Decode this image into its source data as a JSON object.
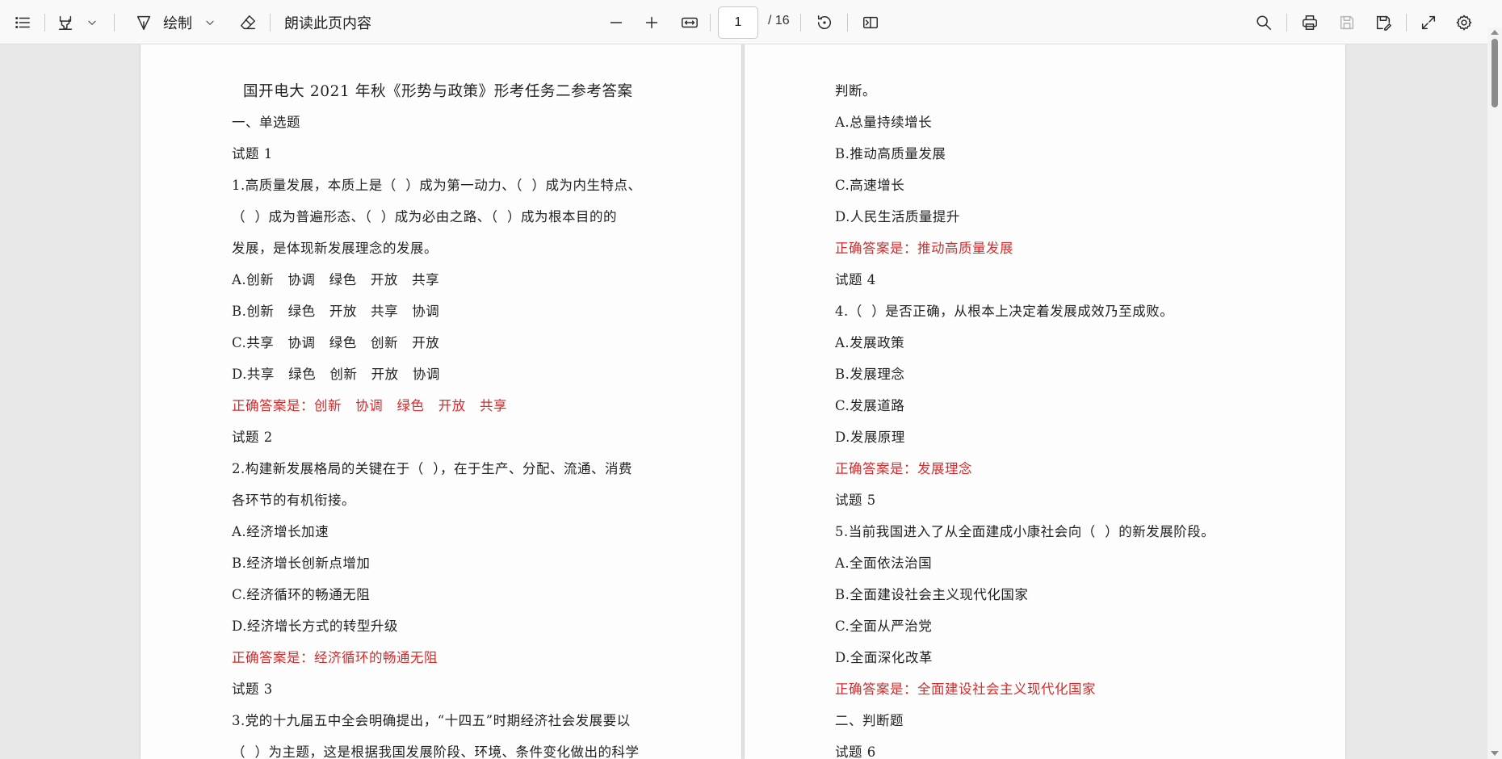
{
  "toolbar": {
    "draw_label": "绘制",
    "read_aloud_label": "朗读此页内容",
    "page_current": "1",
    "page_total": "/ 16"
  },
  "pages": {
    "left": [
      {
        "text": "国开电大 2021 年秋《形势与政策》形考任务二参考答案",
        "type": "title"
      },
      {
        "text": "一、单选题",
        "type": "normal"
      },
      {
        "text": "试题 1",
        "type": "normal"
      },
      {
        "text": "1.高质量发展，本质上是（  ）成为第一动力、（  ）成为内生特点、",
        "type": "normal"
      },
      {
        "text": "（  ）成为普遍形态、（  ）成为必由之路、（  ）成为根本目的的",
        "type": "normal"
      },
      {
        "text": "发展，是体现新发展理念的发展。",
        "type": "normal"
      },
      {
        "text": "A.创新   协调   绿色   开放   共享",
        "type": "normal"
      },
      {
        "text": "B.创新   绿色   开放   共享   协调",
        "type": "normal"
      },
      {
        "text": "C.共享   协调   绿色   创新   开放",
        "type": "normal"
      },
      {
        "text": "D.共享   绿色   创新   开放   协调",
        "type": "normal"
      },
      {
        "text": "正确答案是：创新   协调   绿色   开放   共享",
        "type": "answer"
      },
      {
        "text": "试题 2",
        "type": "normal"
      },
      {
        "text": "2.构建新发展格局的关键在于（  ），在于生产、分配、流通、消费",
        "type": "normal"
      },
      {
        "text": "各环节的有机衔接。",
        "type": "normal"
      },
      {
        "text": "A.经济增长加速",
        "type": "normal"
      },
      {
        "text": "B.经济增长创新点增加",
        "type": "normal"
      },
      {
        "text": "C.经济循环的畅通无阻",
        "type": "normal"
      },
      {
        "text": "D.经济增长方式的转型升级",
        "type": "normal"
      },
      {
        "text": "正确答案是：经济循环的畅通无阻",
        "type": "answer"
      },
      {
        "text": "试题 3",
        "type": "normal"
      },
      {
        "text": "3.党的十九届五中全会明确提出，“十四五”时期经济社会发展要以",
        "type": "normal"
      },
      {
        "text": "（  ）为主题，这是根据我国发展阶段、环境、条件变化做出的科学",
        "type": "normal"
      }
    ],
    "right": [
      {
        "text": "判断。",
        "type": "normal"
      },
      {
        "text": "A.总量持续增长",
        "type": "normal"
      },
      {
        "text": "B.推动高质量发展",
        "type": "normal"
      },
      {
        "text": "C.高速增长",
        "type": "normal"
      },
      {
        "text": "D.人民生活质量提升",
        "type": "normal"
      },
      {
        "text": "正确答案是：推动高质量发展",
        "type": "answer"
      },
      {
        "text": "试题 4",
        "type": "normal"
      },
      {
        "text": "4.（  ）是否正确，从根本上决定着发展成效乃至成败。",
        "type": "normal"
      },
      {
        "text": "A.发展政策",
        "type": "normal"
      },
      {
        "text": "B.发展理念",
        "type": "normal"
      },
      {
        "text": "C.发展道路",
        "type": "normal"
      },
      {
        "text": "D.发展原理",
        "type": "normal"
      },
      {
        "text": "正确答案是：发展理念",
        "type": "answer"
      },
      {
        "text": "试题 5",
        "type": "normal"
      },
      {
        "text": "5.当前我国进入了从全面建成小康社会向（  ）的新发展阶段。",
        "type": "normal"
      },
      {
        "text": "A.全面依法治国",
        "type": "normal"
      },
      {
        "text": "B.全面建设社会主义现代化国家",
        "type": "normal"
      },
      {
        "text": "C.全面从严治党",
        "type": "normal"
      },
      {
        "text": "D.全面深化改革",
        "type": "normal"
      },
      {
        "text": "正确答案是：全面建设社会主义现代化国家",
        "type": "answer"
      },
      {
        "text": "二、判断题",
        "type": "normal"
      },
      {
        "text": "试题 6",
        "type": "normal"
      }
    ]
  },
  "colors": {
    "answer": "#d42c2c",
    "page_bg": "#fdfdfd",
    "viewer_bg": "#e8e8e8"
  }
}
